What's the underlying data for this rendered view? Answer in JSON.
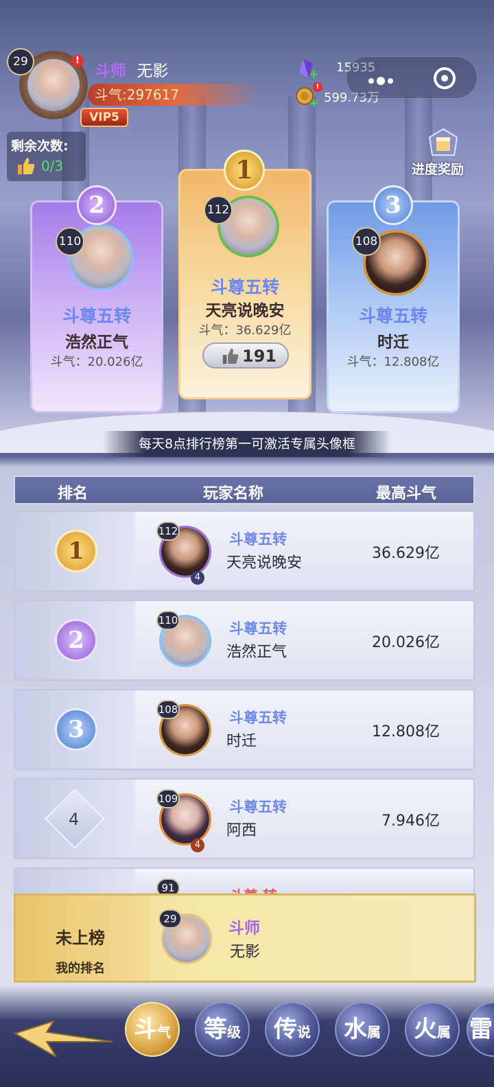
{
  "player": {
    "level": "29",
    "title": "斗师",
    "name": "无影",
    "power_label": "斗气:297617",
    "vip": "VIP5",
    "alert": "!"
  },
  "currency": {
    "gems": "15935",
    "gold": "599.73万"
  },
  "remaining": {
    "label": "剩余次数:",
    "value": "0/3"
  },
  "progress_reward": "进度奖励",
  "podium": [
    {
      "place": "2",
      "level": "110",
      "rank": "斗尊五转",
      "name": "浩然正气",
      "power": "斗气：20.026亿"
    },
    {
      "place": "1",
      "level": "112",
      "rank": "斗尊五转",
      "name": "天亮说晚安",
      "power": "斗气：36.629亿",
      "likes": "191"
    },
    {
      "place": "3",
      "level": "108",
      "rank": "斗尊五转",
      "name": "时迁",
      "power": "斗气：12.808亿"
    }
  ],
  "notice": "每天8点排行榜第一可激活专属头像框",
  "table": {
    "headers": [
      "排名",
      "玩家名称",
      "最高斗气"
    ],
    "rows": [
      {
        "place": "1",
        "level": "112",
        "star": "4",
        "rank": "斗尊五转",
        "name": "天亮说晚安",
        "value": "36.629亿"
      },
      {
        "place": "2",
        "level": "110",
        "star": "",
        "rank": "斗尊五转",
        "name": "浩然正气",
        "value": "20.026亿"
      },
      {
        "place": "3",
        "level": "108",
        "star": "",
        "rank": "斗尊五转",
        "name": "时迁",
        "value": "12.808亿"
      },
      {
        "place": "4",
        "level": "109",
        "star": "4",
        "rank": "斗尊五转",
        "name": "阿西",
        "value": "7.946亿"
      },
      {
        "place": "",
        "level": "91",
        "star": "",
        "rank": "斗尊 转",
        "name": "",
        "value": ""
      }
    ]
  },
  "my_rank": {
    "status": "未上榜",
    "label": "我的排名",
    "level": "29",
    "title": "斗师",
    "name": "无影"
  },
  "tabs": [
    {
      "top": "斗",
      "bottom": "气"
    },
    {
      "top": "等",
      "bottom": "级"
    },
    {
      "top": "传",
      "bottom": "说"
    },
    {
      "top": "水",
      "bottom": "属"
    },
    {
      "top": "火",
      "bottom": "属"
    },
    {
      "top": "雷",
      "bottom": ""
    }
  ]
}
